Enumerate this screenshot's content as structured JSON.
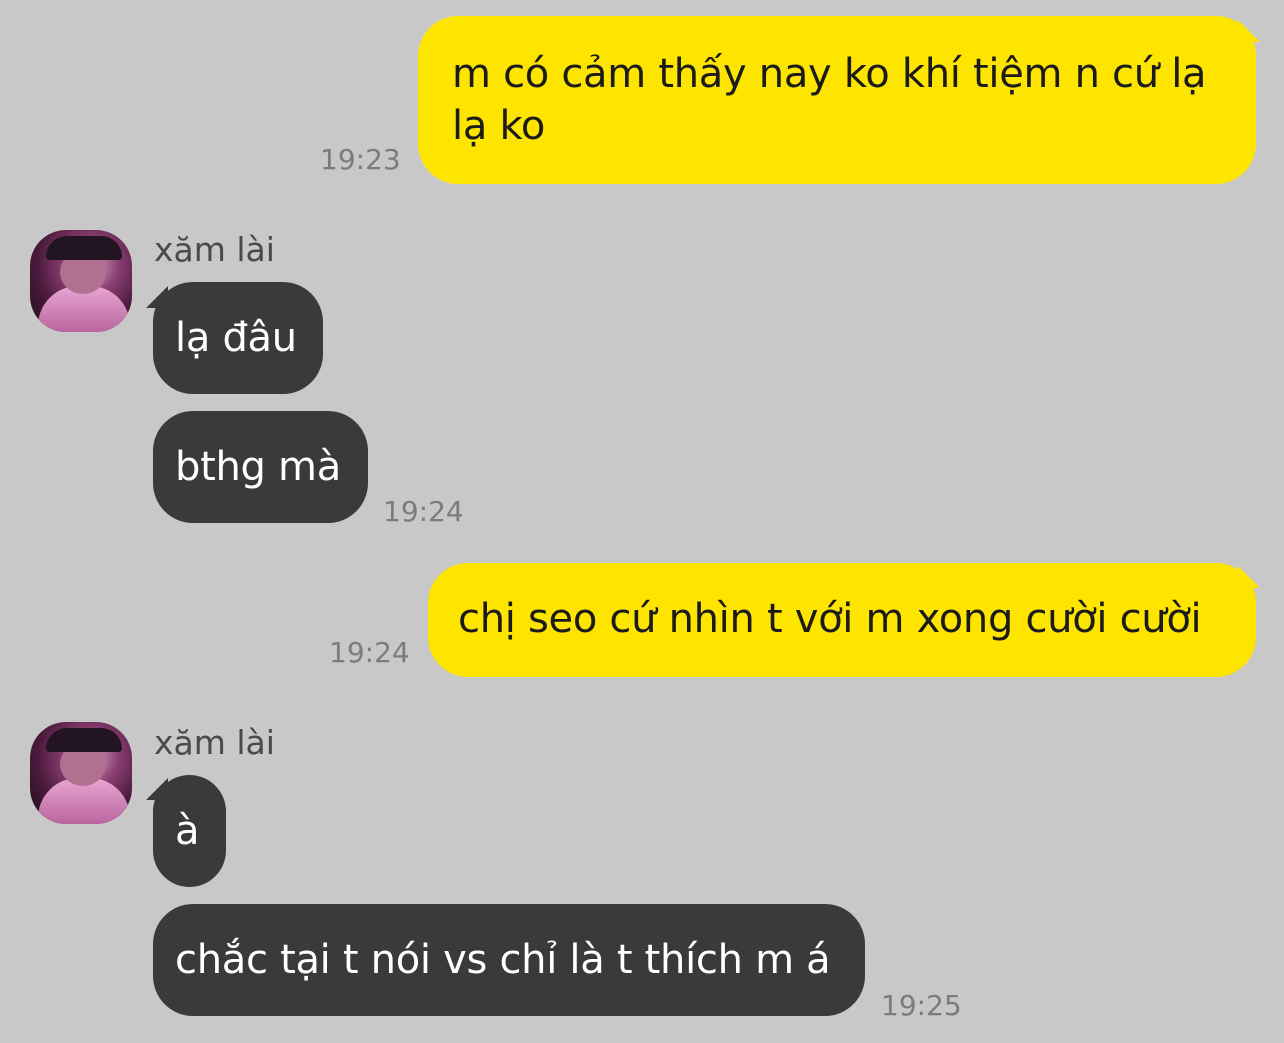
{
  "chat": {
    "messages": [
      {
        "from": "me",
        "text": "m có cảm thấy nay ko khí tiệm n cứ lạ lạ ko",
        "time": "19:23"
      },
      {
        "from": "other",
        "sender": "xăm lài",
        "texts": [
          "lạ đâu",
          "bthg mà"
        ],
        "time": "19:24"
      },
      {
        "from": "me",
        "text": "chị seo cứ nhìn t với m xong cười cười",
        "time": "19:24"
      },
      {
        "from": "other",
        "sender": "xăm lài",
        "texts": [
          "à",
          "chắc tại t nói vs chỉ là t thích m á"
        ],
        "time": "19:25"
      }
    ]
  },
  "colors": {
    "background": "#c8c8c8",
    "outgoing_bubble": "#fee500",
    "incoming_bubble": "#3a3a3c",
    "timestamp": "#7c7c7c"
  },
  "icons": {
    "avatar": "profile-avatar"
  }
}
